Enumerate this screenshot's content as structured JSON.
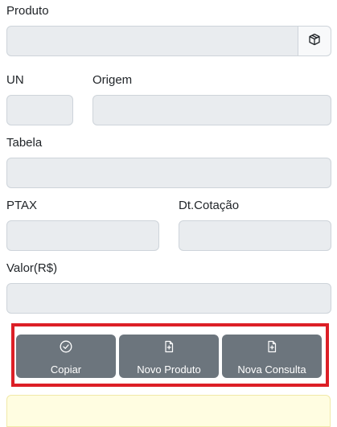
{
  "form": {
    "produto": {
      "label": "Produto",
      "value": ""
    },
    "un": {
      "label": "UN",
      "value": ""
    },
    "origem": {
      "label": "Origem",
      "value": ""
    },
    "tabela": {
      "label": "Tabela",
      "value": ""
    },
    "ptax": {
      "label": "PTAX",
      "value": ""
    },
    "dt_cotacao": {
      "label": "Dt.Cotação",
      "value": ""
    },
    "valor": {
      "label": "Valor(R$)",
      "value": ""
    }
  },
  "actions": {
    "copiar": "Copiar",
    "novo_produto": "Novo Produto",
    "nova_consulta": "Nova Consulta"
  },
  "icons": {
    "produto_addon": "box-icon",
    "copiar": "check-circle-icon",
    "novo_produto": "file-plus-icon",
    "nova_consulta": "file-plus-icon"
  },
  "colors": {
    "field_bg": "#e9ecef",
    "button_bg": "#6c757d",
    "highlight_border": "#dc1f26",
    "alert_bg": "#fffde1"
  }
}
